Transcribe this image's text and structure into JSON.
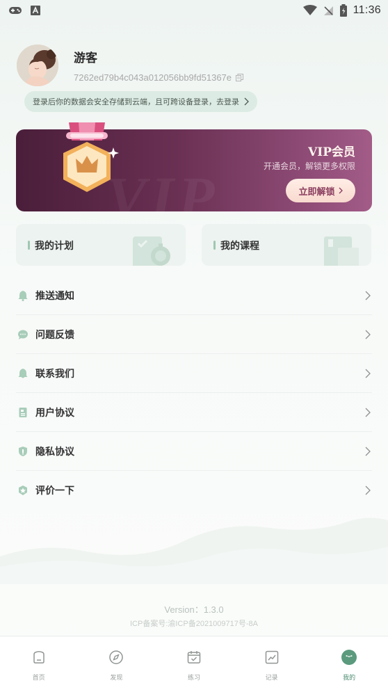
{
  "status_bar": {
    "time": "11:36"
  },
  "profile": {
    "username": "游客",
    "user_id": "7262ed79b4c043a012056bb9fd51367e"
  },
  "login_tip": "登录后你的数据会安全存储到云端，且可跨设备登录，去登录",
  "vip": {
    "title": "VIP会员",
    "subtitle": "开通会员，解锁更多权限",
    "button": "立即解锁",
    "watermark": "VIP"
  },
  "tiles": {
    "plan": "我的计划",
    "course": "我的课程"
  },
  "menu": [
    {
      "label": "推送通知",
      "icon": "bell-icon"
    },
    {
      "label": "问题反馈",
      "icon": "chat-bubble-icon"
    },
    {
      "label": "联系我们",
      "icon": "contact-icon"
    },
    {
      "label": "用户协议",
      "icon": "document-icon"
    },
    {
      "label": "隐私协议",
      "icon": "shield-icon"
    },
    {
      "label": "评价一下",
      "icon": "rate-icon"
    }
  ],
  "footer": {
    "version": "Version：1.3.0",
    "icp": "ICP备案号:渝ICP备2021009717号-8A"
  },
  "nav": [
    {
      "label": "首页",
      "icon": "home-icon"
    },
    {
      "label": "发现",
      "icon": "compass-icon"
    },
    {
      "label": "练习",
      "icon": "calendar-check-icon"
    },
    {
      "label": "记录",
      "icon": "chart-icon"
    },
    {
      "label": "我的",
      "icon": "profile-face-icon",
      "active": true
    }
  ],
  "colors": {
    "accent": "#4a8a6e",
    "vip_gradient_start": "#4a1e3a",
    "vip_gradient_end": "#a25c87"
  }
}
